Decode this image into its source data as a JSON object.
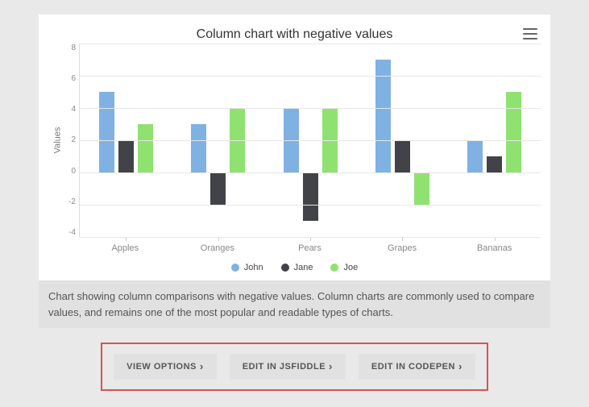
{
  "chart_data": {
    "type": "bar",
    "title": "Column chart with negative values",
    "ylabel": "Values",
    "ylim": [
      -4,
      8
    ],
    "yticks": [
      8,
      6,
      4,
      2,
      0,
      -2,
      -4
    ],
    "categories": [
      "Apples",
      "Oranges",
      "Pears",
      "Grapes",
      "Bananas"
    ],
    "series": [
      {
        "name": "John",
        "color": "#7fb1e3",
        "values": [
          5,
          3,
          4,
          7,
          2
        ]
      },
      {
        "name": "Jane",
        "color": "#424348",
        "values": [
          2,
          -2,
          -3,
          2,
          1
        ]
      },
      {
        "name": "Joe",
        "color": "#8fe270",
        "values": [
          3,
          4,
          4,
          -2,
          5
        ]
      }
    ]
  },
  "description": "Chart showing column comparisons with negative values. Column charts are commonly used to compare values, and remains one of the most popular and readable types of charts.",
  "buttons": {
    "view_options": "VIEW OPTIONS",
    "edit_jsfiddle": "EDIT IN JSFIDDLE",
    "edit_codepen": "EDIT IN CODEPEN"
  },
  "menu_icon": "hamburger-icon"
}
